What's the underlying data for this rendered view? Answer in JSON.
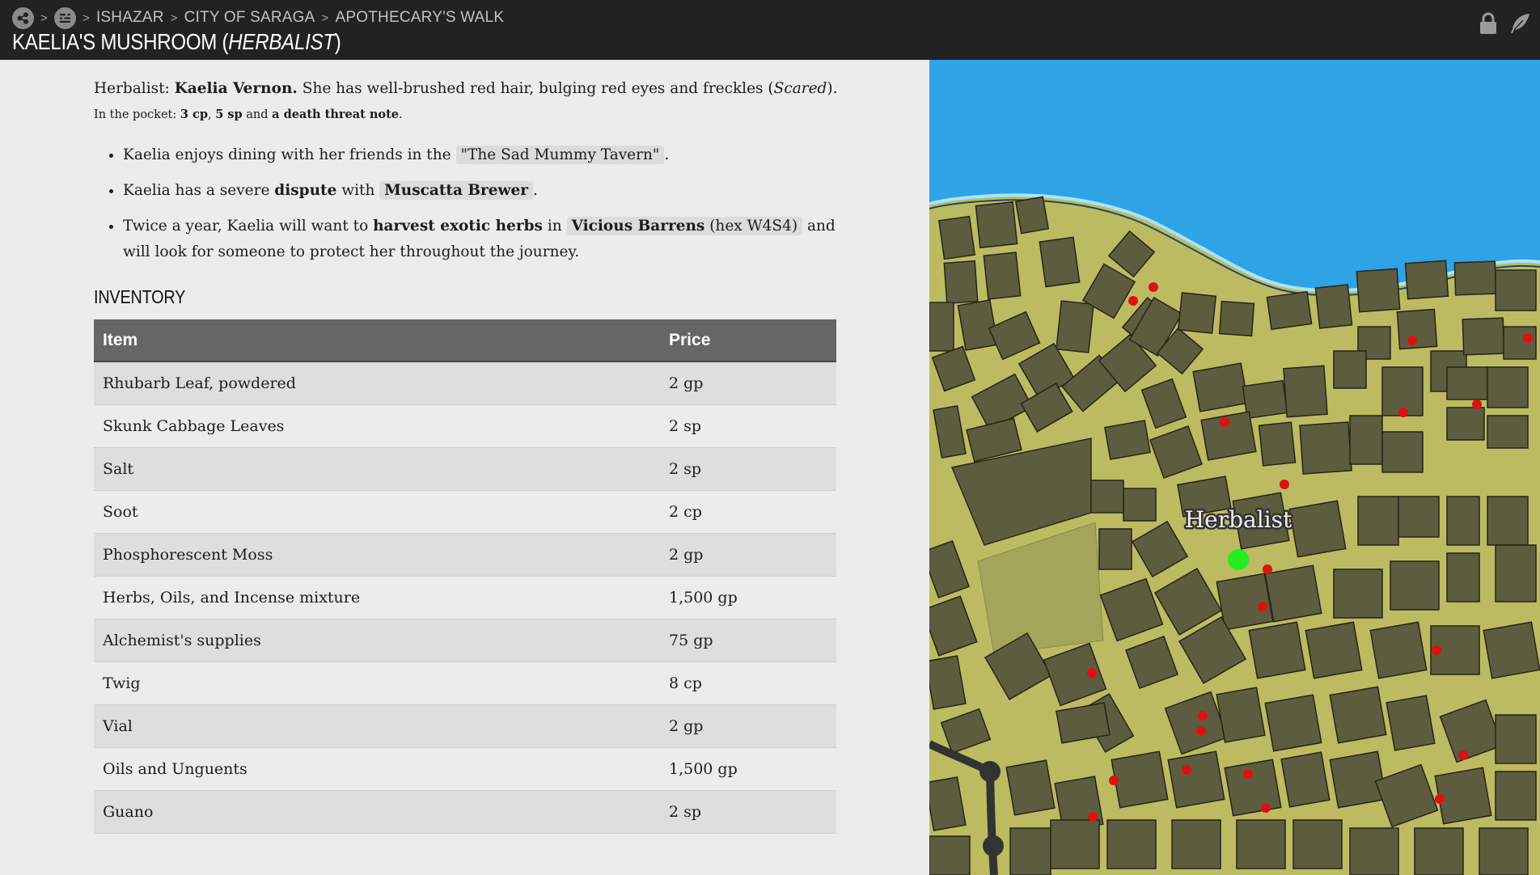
{
  "breadcrumb": {
    "items": [
      "ISHAZAR",
      "CITY OF SARAGA",
      "APOTHECARY'S WALK"
    ],
    "separator": ">"
  },
  "page_title": {
    "name": "KAELIA'S MUSHROOM (",
    "role": "HERBALIST",
    "close": ")"
  },
  "npc": {
    "role_label": "Herbalist:",
    "name": "Kaelia Vernon.",
    "description": "She has well-brushed red hair, bulging red eyes and freckles (",
    "mood": "Scared",
    "mood_close": ").",
    "pocket_prefix": "In the pocket:",
    "pocket_cp": "3 cp",
    "pocket_sep": ",",
    "pocket_sp": "5 sp",
    "pocket_and": "and",
    "pocket_note": "a death threat note",
    "pocket_end": "."
  },
  "traits": [
    {
      "before": "Kaelia enjoys dining with her friends in the",
      "chip": "\"The Sad Mummy Tavern\"",
      "after": "."
    },
    {
      "before": "Kaelia has a severe",
      "bold": "dispute",
      "mid": "with",
      "chip": "Muscatta Brewer",
      "after": "."
    },
    {
      "before": "Twice a year, Kaelia will want to",
      "bold": "harvest exotic herbs",
      "mid": "in",
      "chip_bold": "Vicious Barrens",
      "chip_rest": "(hex W4S4)",
      "after": "and will look for someone to protect her throughout the journey."
    }
  ],
  "inventory": {
    "heading": "INVENTORY",
    "columns": [
      "Item",
      "Price"
    ],
    "rows": [
      [
        "Rhubarb Leaf, powdered",
        "2 gp"
      ],
      [
        "Skunk Cabbage Leaves",
        "2 sp"
      ],
      [
        "Salt",
        "2 sp"
      ],
      [
        "Soot",
        "2 cp"
      ],
      [
        "Phosphorescent Moss",
        "2 gp"
      ],
      [
        "Herbs, Oils, and Incense mixture",
        "1,500 gp"
      ],
      [
        "Alchemist's supplies",
        "75 gp"
      ],
      [
        "Twig",
        "8 cp"
      ],
      [
        "Vial",
        "2 gp"
      ],
      [
        "Oils and Unguents",
        "1,500 gp"
      ],
      [
        "Guano",
        "2 sp"
      ]
    ]
  },
  "map": {
    "label": "Herbalist",
    "colors": {
      "water": "#2ea3e6",
      "ground": "#bdbb62",
      "building": "#5e5c3e",
      "marker": "#dd1111",
      "current": "#22ee22"
    }
  },
  "icons": [
    "hub-icon",
    "menu-icon",
    "lock-icon",
    "feather-icon"
  ]
}
